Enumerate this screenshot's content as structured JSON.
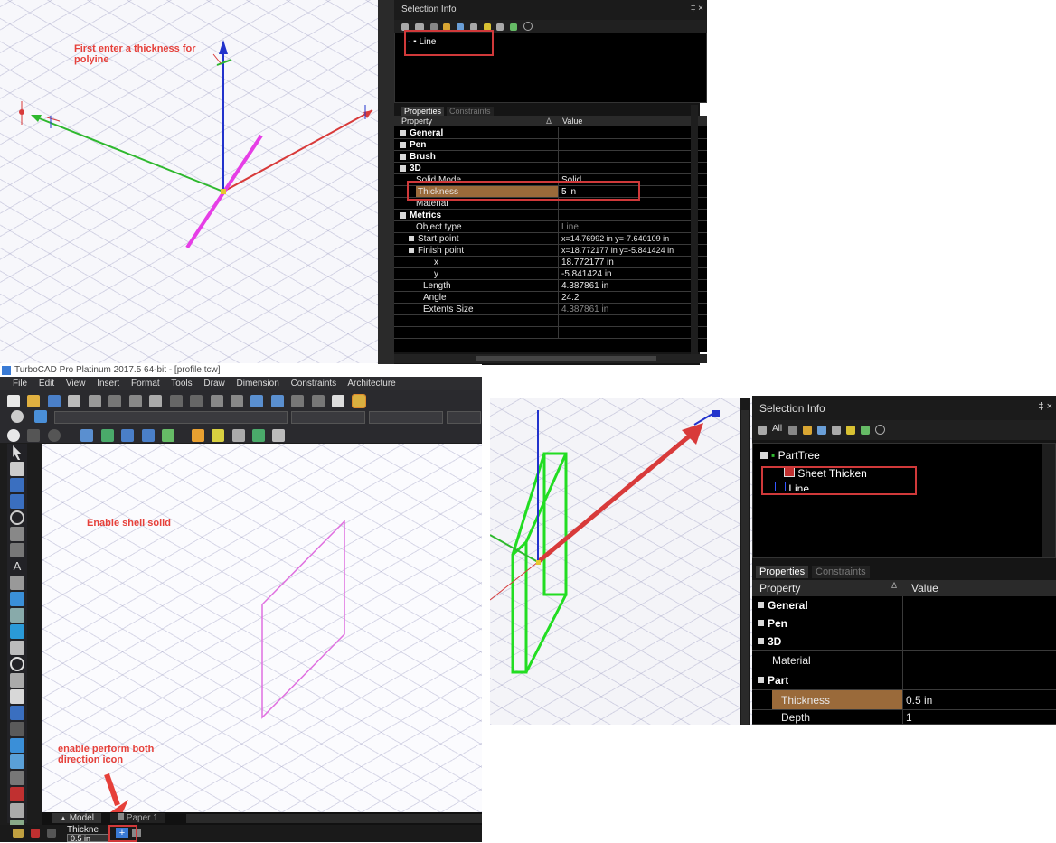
{
  "top_left": {
    "annotation": "First enter a thickness for polyine"
  },
  "selection_info_1": {
    "title": "Selection Info",
    "controls": "‡ ×",
    "tree_item": "Line",
    "tabs": [
      "Properties",
      "Constraints"
    ],
    "col_property": "Property",
    "col_value": "Value",
    "sort_arrow": "Δ",
    "rows": [
      {
        "name": "General",
        "value": ""
      },
      {
        "name": "Pen",
        "value": ""
      },
      {
        "name": "Brush",
        "value": ""
      },
      {
        "name": "3D",
        "value": ""
      },
      {
        "name": "Solid Mode",
        "value": "Solid"
      },
      {
        "name": "Thickness",
        "value": "5 in"
      },
      {
        "name": "Material",
        "value": ""
      },
      {
        "name": "Metrics",
        "value": ""
      },
      {
        "name": "Object type",
        "value": "Line"
      },
      {
        "name": "Start point",
        "value": "x=14.76992 in y=-7.640109 in"
      },
      {
        "name": "Finish point",
        "value": "x=18.772177 in y=-5.841424 in"
      },
      {
        "name": "x",
        "value": "18.772177 in"
      },
      {
        "name": "y",
        "value": "-5.841424 in"
      },
      {
        "name": "Length",
        "value": "4.387861 in"
      },
      {
        "name": "Angle",
        "value": "24.2"
      },
      {
        "name": "Extents Size",
        "value": "4.387861 in"
      }
    ]
  },
  "turbocad_window": {
    "title": "TurboCAD Pro Platinum 2017.5 64-bit - [profile.tcw]",
    "menu": [
      "File",
      "Edit",
      "View",
      "Insert",
      "Format",
      "Tools",
      "Draw",
      "Dimension",
      "Constraints",
      "Architecture"
    ],
    "annotation_shell": "Enable shell solid",
    "annotation_direction": "enable perform both direction icon",
    "tabs": [
      "Model",
      "Paper 1"
    ],
    "thickness_label": "Thickne",
    "thickness_value": "0.5 in"
  },
  "selection_info_2": {
    "title": "Selection Info",
    "controls": "‡ ×",
    "toolbar_all": "All",
    "tree": [
      "PartTree",
      "Sheet Thicken",
      "Line"
    ],
    "tabs": [
      "Properties",
      "Constraints"
    ],
    "col_property": "Property",
    "col_value": "Value",
    "sort_arrow": "Δ",
    "rows": [
      {
        "name": "General",
        "value": ""
      },
      {
        "name": "Pen",
        "value": ""
      },
      {
        "name": "3D",
        "value": ""
      },
      {
        "name": "Material",
        "value": ""
      },
      {
        "name": "Part",
        "value": ""
      },
      {
        "name": "Thickness",
        "value": "0.5 in"
      },
      {
        "name": "Depth",
        "value": "1"
      }
    ]
  },
  "colors": {
    "annotation_red": "#e6403a",
    "highlight": "#9a6a3a",
    "axis_red": "#d83a3a",
    "axis_green": "#2eb82e",
    "axis_blue": "#2233cc",
    "magenta": "#e63ee6",
    "panel_bg": "#0b0b0b"
  }
}
